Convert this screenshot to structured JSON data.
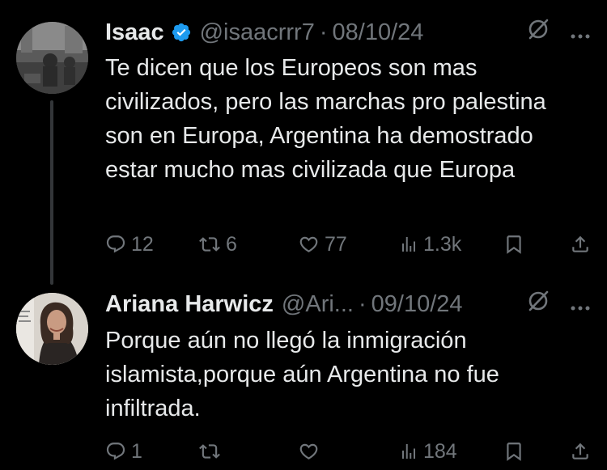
{
  "tweets": [
    {
      "author_name": "Isaac",
      "handle": "@isaacrrr7",
      "separator": "·",
      "date": "08/10/24",
      "verified": true,
      "text": "Te dicen que los Europeos son mas civilizados, pero las marchas pro palestina son en Europa, Argentina ha demostrado estar mucho mas civilizada que Europa",
      "replies": "12",
      "reposts": "6",
      "likes": "77",
      "views": "1.3k"
    },
    {
      "author_name": "Ariana Harwicz",
      "handle": "@Ari...",
      "separator": "·",
      "date": "09/10/24",
      "verified": false,
      "text": "Porque aún no llegó la inmigración islamista,porque aún Argentina no fue infiltrada.",
      "replies": "1",
      "reposts": "",
      "likes": "",
      "views": "184"
    }
  ],
  "colors": {
    "background": "#000000",
    "text": "#e7e9ea",
    "secondary": "#71767b",
    "verified_badge": "#1d9bf0",
    "thread_line": "#333639"
  }
}
